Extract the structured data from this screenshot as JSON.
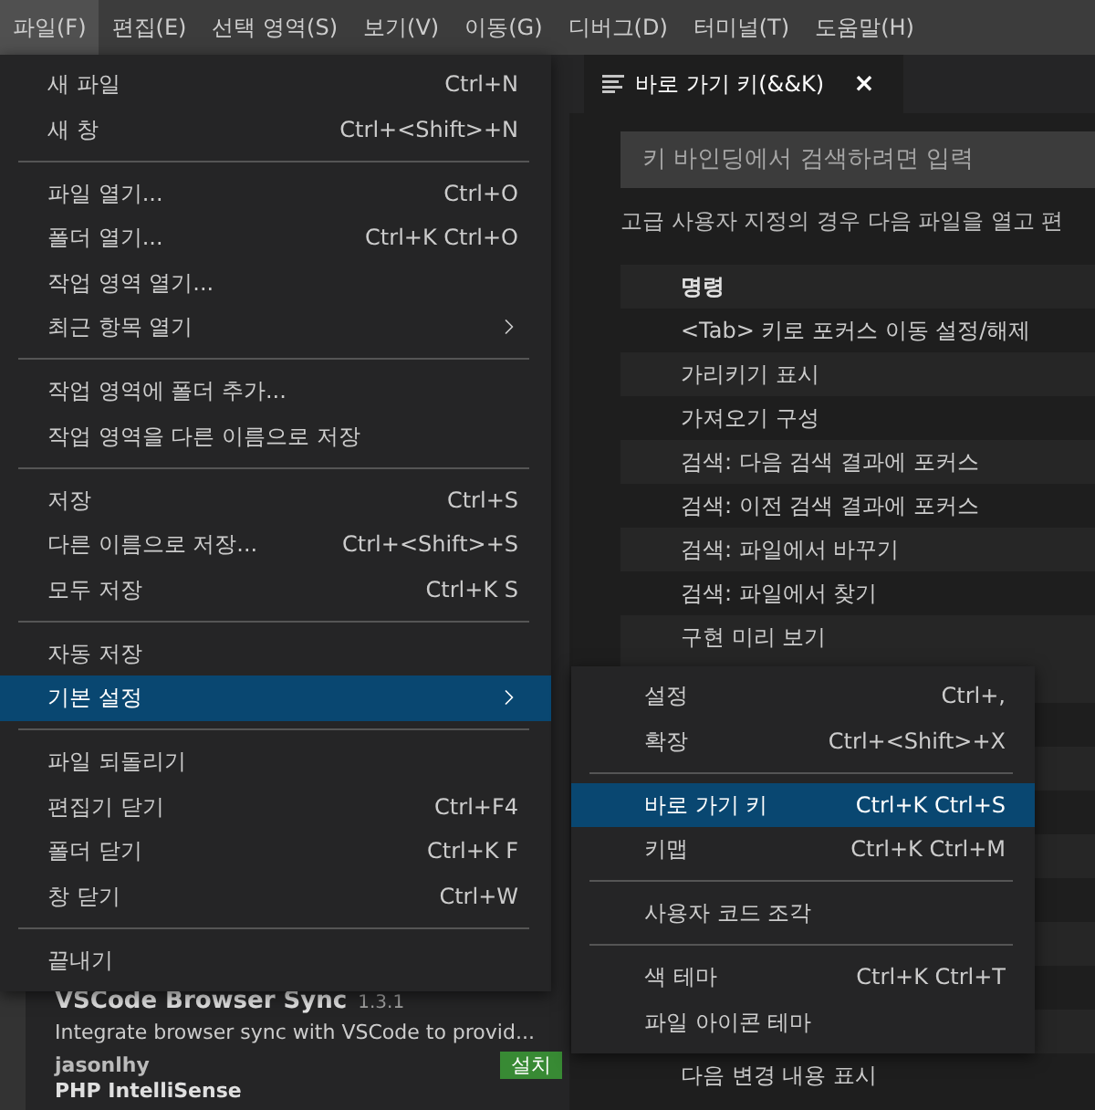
{
  "menubar": [
    {
      "label": "파일(F)",
      "selected": true
    },
    {
      "label": "편집(E)",
      "selected": false
    },
    {
      "label": "선택 영역(S)",
      "selected": false
    },
    {
      "label": "보기(V)",
      "selected": false
    },
    {
      "label": "이동(G)",
      "selected": false
    },
    {
      "label": "디버그(D)",
      "selected": false
    },
    {
      "label": "터미널(T)",
      "selected": false
    },
    {
      "label": "도움말(H)",
      "selected": false
    }
  ],
  "file_menu": [
    {
      "kind": "item",
      "label": "새 파일",
      "shortcut": "Ctrl+N",
      "selected": false
    },
    {
      "kind": "item",
      "label": "새 창",
      "shortcut": "Ctrl+<Shift>+N",
      "selected": false
    },
    {
      "kind": "separator"
    },
    {
      "kind": "item",
      "label": "파일 열기...",
      "shortcut": "Ctrl+O",
      "selected": false
    },
    {
      "kind": "item",
      "label": "폴더 열기...",
      "shortcut": "Ctrl+K Ctrl+O",
      "selected": false
    },
    {
      "kind": "item",
      "label": "작업 영역 열기...",
      "selected": false
    },
    {
      "kind": "submenu",
      "label": "최근 항목 열기",
      "selected": false
    },
    {
      "kind": "separator"
    },
    {
      "kind": "item",
      "label": "작업 영역에 폴더 추가...",
      "selected": false
    },
    {
      "kind": "item",
      "label": "작업 영역을 다른 이름으로 저장",
      "selected": false
    },
    {
      "kind": "separator"
    },
    {
      "kind": "item",
      "label": "저장",
      "shortcut": "Ctrl+S",
      "selected": false
    },
    {
      "kind": "item",
      "label": "다른 이름으로 저장...",
      "shortcut": "Ctrl+<Shift>+S",
      "selected": false
    },
    {
      "kind": "item",
      "label": "모두 저장",
      "shortcut": "Ctrl+K S",
      "selected": false
    },
    {
      "kind": "separator"
    },
    {
      "kind": "item",
      "label": "자동 저장",
      "selected": false
    },
    {
      "kind": "submenu",
      "label": "기본 설정",
      "selected": true
    },
    {
      "kind": "separator"
    },
    {
      "kind": "item",
      "label": "파일 되돌리기",
      "selected": false
    },
    {
      "kind": "item",
      "label": "편집기 닫기",
      "shortcut": "Ctrl+F4",
      "selected": false
    },
    {
      "kind": "item",
      "label": "폴더 닫기",
      "shortcut": "Ctrl+K F",
      "selected": false
    },
    {
      "kind": "item",
      "label": "창 닫기",
      "shortcut": "Ctrl+W",
      "selected": false
    },
    {
      "kind": "separator"
    },
    {
      "kind": "item",
      "label": "끝내기",
      "selected": false
    }
  ],
  "preferences_menu": [
    {
      "kind": "item",
      "label": "설정",
      "shortcut": "Ctrl+,",
      "selected": false
    },
    {
      "kind": "item",
      "label": "확장",
      "shortcut": "Ctrl+<Shift>+X",
      "selected": false
    },
    {
      "kind": "separator"
    },
    {
      "kind": "item",
      "label": "바로 가기 키",
      "shortcut": "Ctrl+K Ctrl+S",
      "selected": true
    },
    {
      "kind": "item",
      "label": "키맵",
      "shortcut": "Ctrl+K Ctrl+M",
      "selected": false
    },
    {
      "kind": "separator"
    },
    {
      "kind": "item",
      "label": "사용자 코드 조각",
      "selected": false
    },
    {
      "kind": "separator"
    },
    {
      "kind": "item",
      "label": "색 테마",
      "shortcut": "Ctrl+K Ctrl+T",
      "selected": false
    },
    {
      "kind": "item",
      "label": "파일 아이콘 테마",
      "selected": false
    }
  ],
  "sidebar": {
    "extensions": [
      {
        "name": "VSCode Browser Sync",
        "version": "1.3.1",
        "description": "Integrate browser sync with VSCode to provid...",
        "author": "jasonlhy",
        "action": "설치"
      },
      {
        "name": "PHP IntelliSense"
      }
    ]
  },
  "editor": {
    "tab": {
      "label": "바로 가기 키(&&K)",
      "close": "×"
    },
    "search": {
      "placeholder": "키 바인딩에서 검색하려면 입력"
    },
    "note": "고급 사용자 지정의 경우 다음 파일을 열고 편",
    "table": {
      "column": "명령",
      "rows": [
        "<Tab> 키로 포커스 이동 설정/해제",
        "가리키기 표시",
        "가져오기 구성",
        "검색: 다음 검색 결과에 포커스",
        "검색: 이전 검색 결과에 포커스",
        "검색: 파일에서 바꾸기",
        "검색: 파일에서 찾기",
        "구현 미리 보기"
      ],
      "rows_below_menu": [
        "다음 변경 내용 표시"
      ]
    }
  }
}
